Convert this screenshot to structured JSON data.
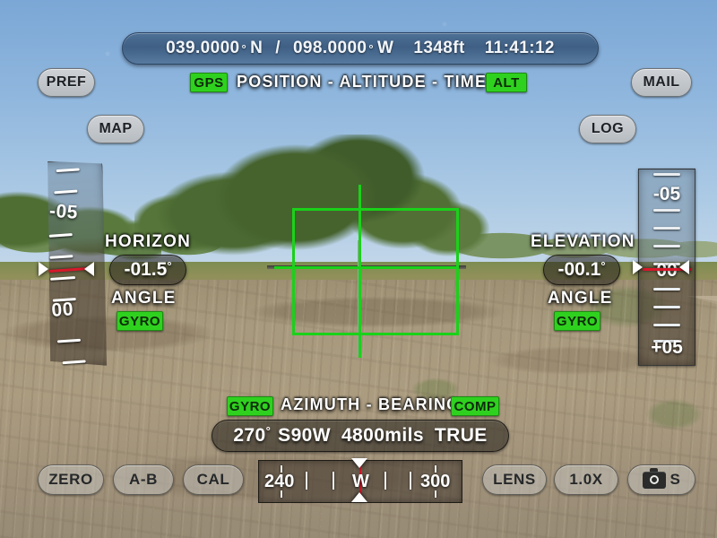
{
  "status_bar": {
    "latitude": "039.0000",
    "lat_hemisphere": "N",
    "separator": "/",
    "longitude": "098.0000",
    "lon_hemisphere": "W",
    "altitude": "1348ft",
    "time": "11:41:12",
    "degree_symbol": "°"
  },
  "top_section": {
    "gps_badge": "GPS",
    "title": "POSITION - ALTITUDE - TIME",
    "alt_badge": "ALT"
  },
  "corner_buttons": {
    "pref": "PREF",
    "map": "MAP",
    "mail": "MAIL",
    "log": "LOG"
  },
  "horizon": {
    "title": "HORIZON",
    "value": "-01.5",
    "degree_symbol": "°",
    "subtitle": "ANGLE",
    "source_badge": "GYRO",
    "scale_labels": [
      "-05",
      "00"
    ]
  },
  "elevation": {
    "title": "ELEVATION",
    "value": "-00.1",
    "degree_symbol": "°",
    "subtitle": "ANGLE",
    "source_badge": "GYRO",
    "scale_labels": [
      "-05",
      "00",
      "+05"
    ]
  },
  "azimuth": {
    "gyro_badge": "GYRO",
    "title": "AZIMUTH - BEARING",
    "comp_badge": "COMP",
    "degrees": "270",
    "degree_symbol": "°",
    "quadrant_bearing": "S90W",
    "mils": "4800mils",
    "reference": "TRUE"
  },
  "compass_strip": {
    "left_label": "240",
    "center_label": "W",
    "right_label": "300"
  },
  "bottom_bar": {
    "zero": "ZERO",
    "ab": "A-B",
    "cal": "CAL",
    "lens": "LENS",
    "zoom_level": "1.0X",
    "camera_mode": "S"
  },
  "colors": {
    "badge_green": "#2fd11f",
    "reticle_green": "#19d219",
    "indicator_red": "#d8182a",
    "status_bar_blue": "#3f5f84"
  }
}
